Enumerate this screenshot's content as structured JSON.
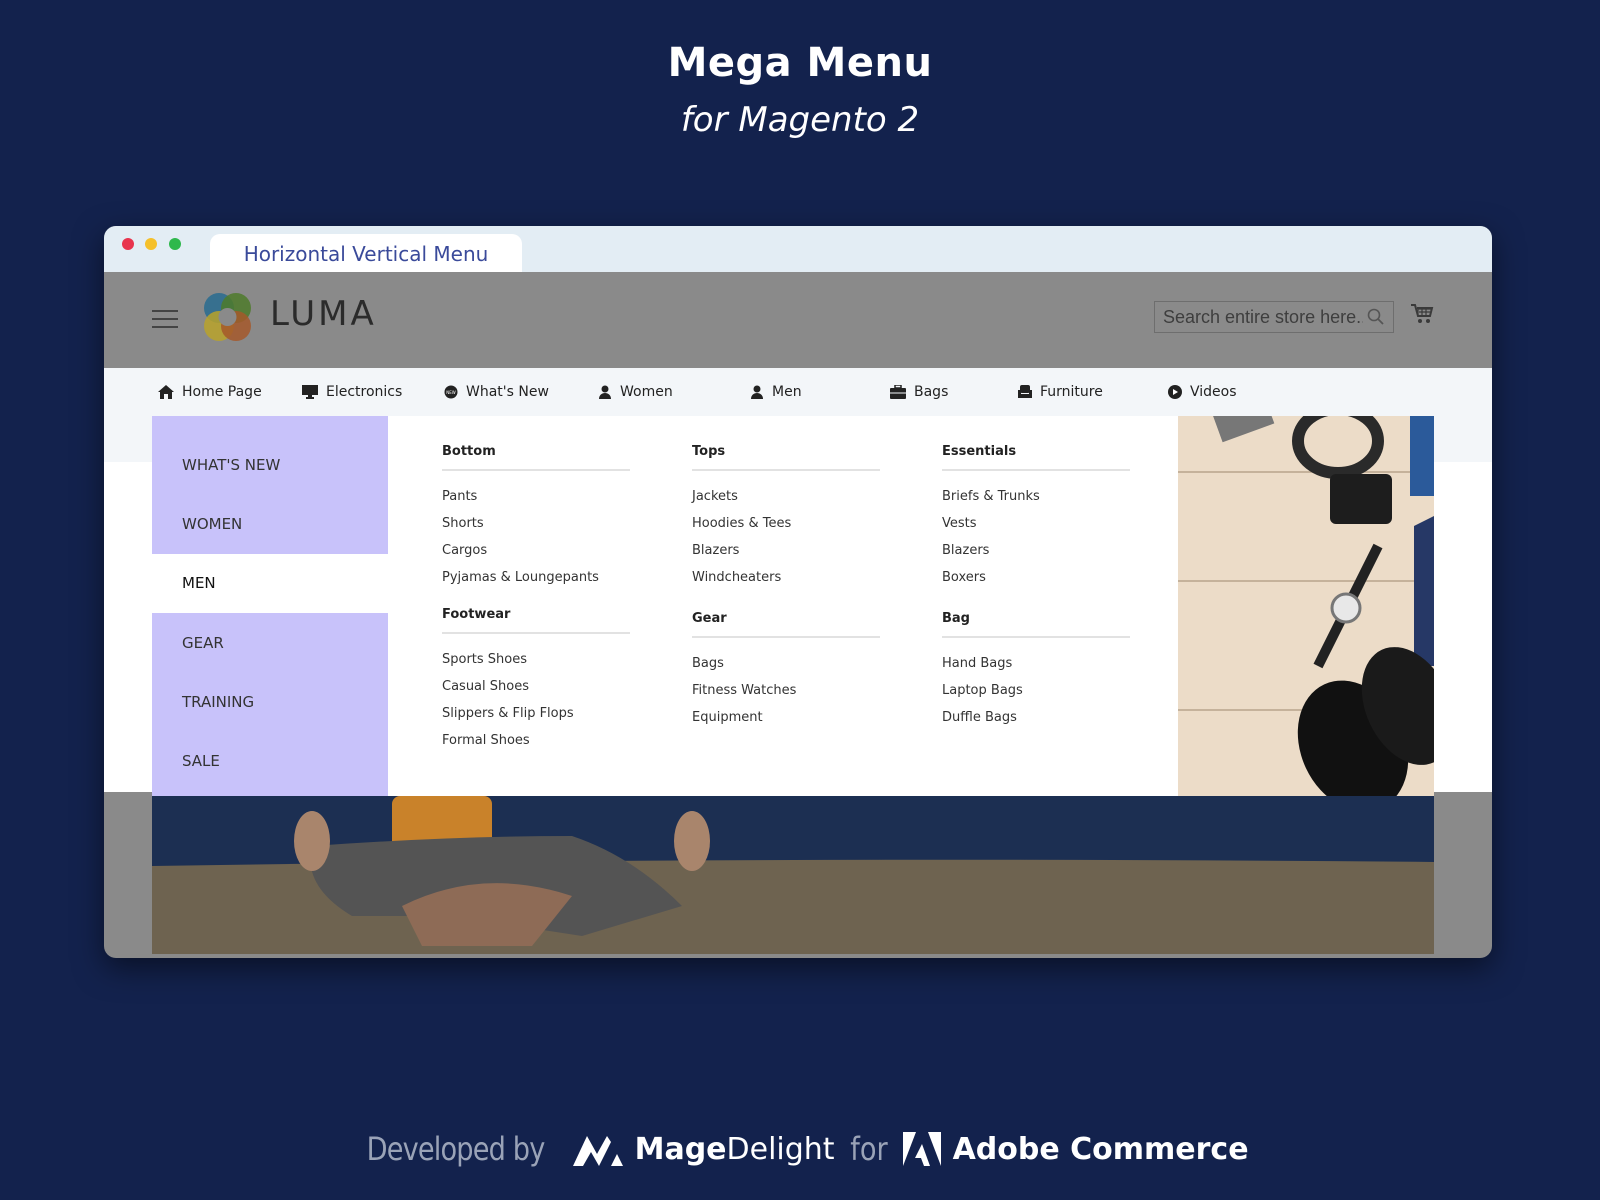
{
  "hero": {
    "title": "Mega Menu",
    "subtitle": "for Magento 2"
  },
  "window": {
    "tab_title": "Horizontal Vertical Menu",
    "traffic_lights": {
      "close": "#e8344d",
      "minimize": "#f5c02a",
      "maximize": "#2fb84c"
    }
  },
  "header": {
    "logo_text": "LUMA",
    "search_placeholder": "Search entire store here...",
    "icons": {
      "menu": "hamburger-icon",
      "search": "search-icon",
      "cart": "cart-icon"
    }
  },
  "nav": {
    "items": [
      {
        "label": "Home Page",
        "icon": "home-icon"
      },
      {
        "label": "Electronics",
        "icon": "monitor-icon"
      },
      {
        "label": "What's New",
        "icon": "new-badge-icon"
      },
      {
        "label": "Women",
        "icon": "user-icon"
      },
      {
        "label": "Men",
        "icon": "user-icon"
      },
      {
        "label": "Bags",
        "icon": "briefcase-icon"
      },
      {
        "label": "Furniture",
        "icon": "armchair-icon"
      },
      {
        "label": "Videos",
        "icon": "play-icon"
      }
    ]
  },
  "vertical_menu": {
    "accent_color": "#c8c2fa",
    "active_index": 2,
    "items": [
      "WHAT'S NEW",
      "WOMEN",
      "MEN",
      "GEAR",
      "TRAINING",
      "SALE"
    ]
  },
  "mega_columns": [
    {
      "groups": [
        {
          "heading": "Bottom",
          "links": [
            "Pants",
            "Shorts",
            "Cargos",
            "Pyjamas & Loungepants"
          ]
        },
        {
          "heading": "Footwear",
          "links": [
            "Sports Shoes",
            "Casual Shoes",
            "Slippers & Flip Flops",
            "Formal Shoes"
          ]
        }
      ]
    },
    {
      "groups": [
        {
          "heading": "Tops",
          "links": [
            "Jackets",
            "Hoodies & Tees",
            "Blazers",
            "Windcheaters"
          ]
        },
        {
          "heading": "Gear",
          "links": [
            "Bags",
            "Fitness Watches",
            "Equipment"
          ]
        }
      ]
    },
    {
      "groups": [
        {
          "heading": "Essentials",
          "links": [
            "Briefs & Trunks",
            "Vests",
            "Blazers",
            "Boxers"
          ]
        },
        {
          "heading": "Bag",
          "links": [
            "Hand Bags",
            "Laptop Bags",
            "Duffle Bags"
          ]
        }
      ]
    }
  ],
  "footer": {
    "developed_by": "Developed by",
    "brand_bold": "Mage",
    "brand_light": "Delight",
    "for": "for",
    "platform": "Adobe Commerce"
  }
}
